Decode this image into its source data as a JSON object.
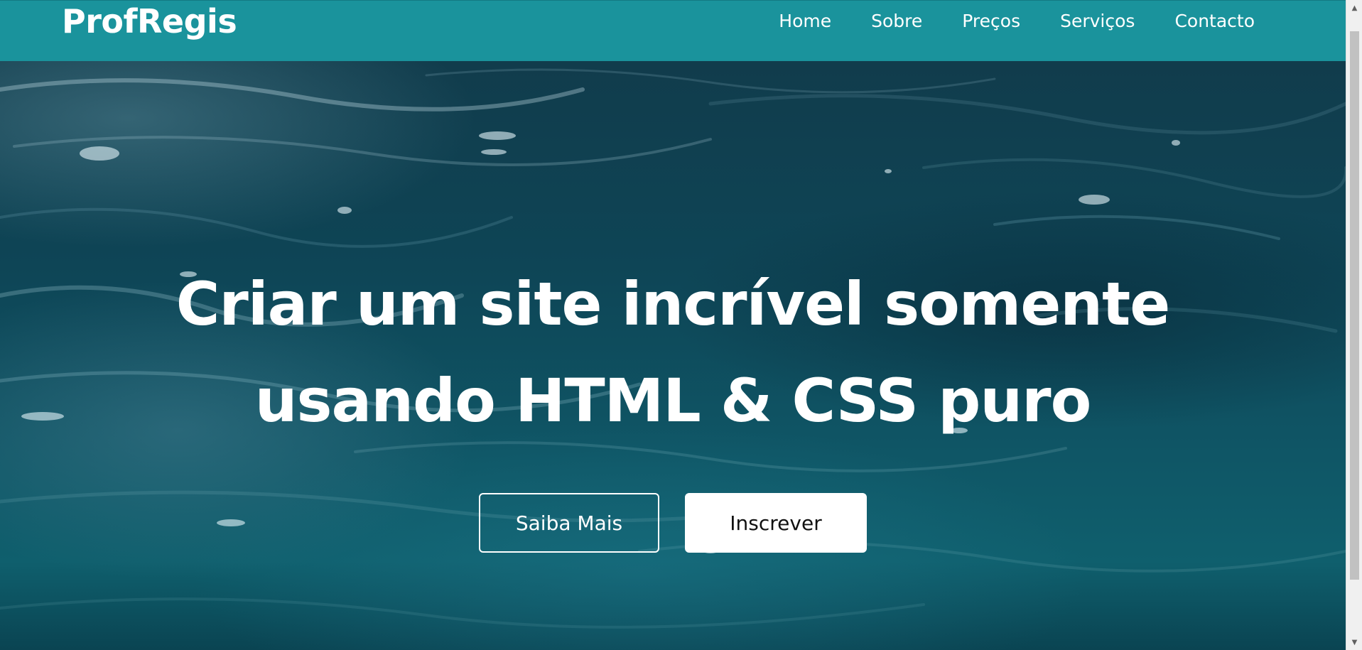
{
  "navbar": {
    "logo": "ProfRegis",
    "links": [
      {
        "label": "Home"
      },
      {
        "label": "Sobre"
      },
      {
        "label": "Preços"
      },
      {
        "label": "Serviços"
      },
      {
        "label": "Contacto"
      }
    ]
  },
  "hero": {
    "title": "Criar um site incrível somente usando HTML & CSS puro",
    "buttons": {
      "learn_more": "Saiba Mais",
      "subscribe": "Inscrever"
    }
  },
  "scrollbar": {
    "up_icon": "chevron-up-icon",
    "down_icon": "chevron-down-icon"
  },
  "colors": {
    "navbar_bg": "#1a939c",
    "hero_water": "#0e4556",
    "text": "#ffffff",
    "button_solid_bg": "#ffffff"
  }
}
